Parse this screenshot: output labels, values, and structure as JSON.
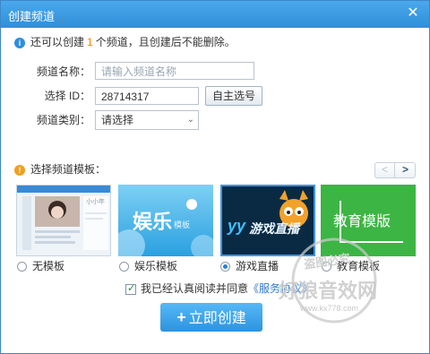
{
  "window": {
    "title": "创建频道",
    "close_glyph": "✕"
  },
  "info": {
    "prefix": "还可以创建",
    "count": "1",
    "suffix": "个频道，且创建后不能删除。"
  },
  "form": {
    "name_label": "频道名称：",
    "name_placeholder": "请输入频道名称",
    "id_label": "选择 ID：",
    "id_value": "28714317",
    "self_select_label": "自主选号",
    "type_label": "频道类别：",
    "type_value": "请选择"
  },
  "templates": {
    "header": "选择频道模板：",
    "pager_prev": "<",
    "pager_next": ">",
    "items": [
      {
        "label": "无模板",
        "selected": false,
        "thumb_text": "小小年"
      },
      {
        "label": "娱乐模板",
        "selected": false,
        "thumb_text": "娱乐",
        "thumb_sub": "模板"
      },
      {
        "label": "游戏直播",
        "selected": true,
        "thumb_text": "游戏直播",
        "thumb_logo": "yy"
      },
      {
        "label": "教育模板",
        "selected": false,
        "thumb_text": "教育模版"
      }
    ]
  },
  "agreement": {
    "checked": true,
    "text": "我已经认真阅读并同意",
    "link": "《服务协议》"
  },
  "create_button": {
    "icon": "+",
    "label": "立即创建"
  },
  "watermark": {
    "line1": "盗图必究",
    "line2": "好狼音效网",
    "url": "www.kx778.com"
  },
  "colors": {
    "title_bar": "#2f8fd8",
    "accent": "#2d93e0",
    "count": "#f08000",
    "link": "#2d7bcf"
  }
}
